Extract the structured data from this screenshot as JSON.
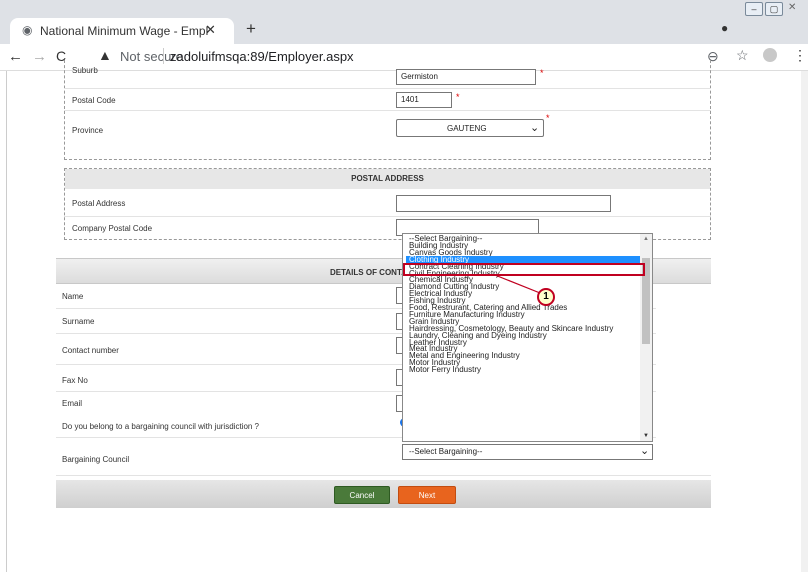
{
  "browser": {
    "tab_title": "National Minimum Wage - Empl",
    "security": "Not secure",
    "url": "zadoluifmsqa:89/Employer.aspx"
  },
  "form": {
    "suburb_label": "Suburb",
    "suburb_value": "Germiston",
    "postal_code_label": "Postal Code",
    "postal_code_value": "1401",
    "province_label": "Province",
    "province_value": "GAUTENG",
    "postal_address_heading": "POSTAL ADDRESS",
    "postal_address_label": "Postal Address",
    "company_postal_code_label": "Company Postal Code",
    "details_heading": "DETAILS OF CONTA",
    "name_label": "Name",
    "surname_label": "Surname",
    "contact_number_label": "Contact number",
    "fax_label": "Fax No",
    "email_label": "Email",
    "bargaining_question": "Do you belong to a bargaining council with jurisdiction ?",
    "bargaining_council_label": "Bargaining Council",
    "bargaining_council_value": "--Select Bargaining--",
    "required_mark": "*"
  },
  "dropdown_options": [
    "--Select Bargaining--",
    "Building Industry",
    "Canvas Goods Industry",
    "Clothing Industry",
    "Contract Cleaning Industry",
    "Civil Engineering Industry",
    "Chemical Industry",
    "Diamond Cutting Industry",
    "Electrical Industry",
    "Fishing Industry",
    "Food, Restrurant, Catering and Allied Trades",
    "Furniture Manufacturing Industry",
    "Grain Industry",
    "Hairdressing, Cosmetology, Beauty and Skincare Industry",
    "Laundry, Cleaning and Dyeing Industry",
    "Leather Industry",
    "Meat Industry",
    "Metal and Engineering Industry",
    "Motor Industry",
    "Motor Ferry Industry"
  ],
  "selected_option_index": 3,
  "callout_number": "1",
  "buttons": {
    "cancel": "Cancel",
    "next": "Next"
  },
  "colors": {
    "selected_highlight": "#1e90ff",
    "callout_border": "#c00020",
    "callout_fill": "#ffffcc",
    "cancel_button": "#4a7a3a",
    "next_button": "#e8641e"
  }
}
